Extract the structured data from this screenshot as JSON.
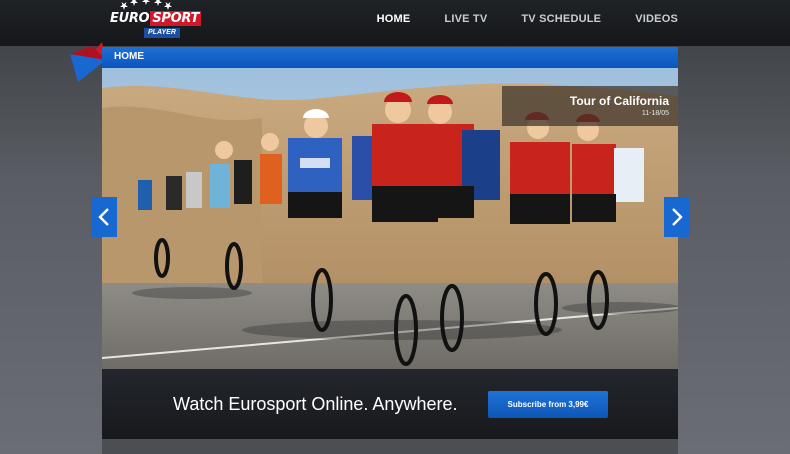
{
  "brand": {
    "logo_word_1": "EURO",
    "logo_word_2": "SPORT",
    "logo_sub": "PLAYER"
  },
  "nav": {
    "items": [
      {
        "label": "HOME",
        "active": true
      },
      {
        "label": "LIVE TV",
        "active": false
      },
      {
        "label": "TV SCHEDULE",
        "active": false
      },
      {
        "label": "VIDEOS",
        "active": false
      }
    ]
  },
  "section": {
    "title": "HOME"
  },
  "hero": {
    "caption_title": "Tour of California",
    "caption_date": "11-18/05",
    "prev_icon": "chevron-left-icon",
    "next_icon": "chevron-right-icon"
  },
  "promo": {
    "tagline": "Watch Eurosport Online. Anywhere.",
    "subscribe_label": "Subscribe from 3,99€"
  },
  "colors": {
    "accent_blue": "#1768d1",
    "brand_red": "#d1182a",
    "topbar": "#1a1c20"
  }
}
